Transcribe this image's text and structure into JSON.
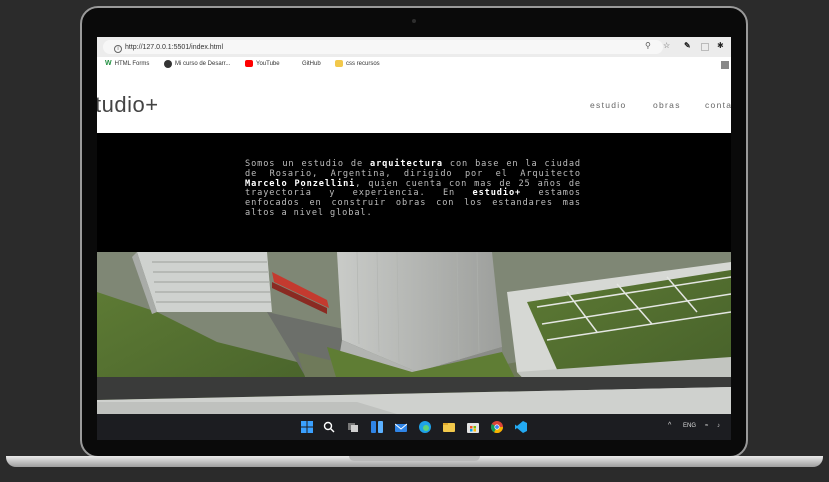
{
  "browser": {
    "url": "http://127.0.0.1:5501/index.html",
    "toolbar_icons": [
      "zoom-icon",
      "star-icon",
      "extension-icon",
      "puzzle-icon"
    ],
    "bookmarks": [
      {
        "label": "HTML Forms",
        "icon": "w-icon",
        "color": "#1e8e3e"
      },
      {
        "label": "Mi curso de Desarr...",
        "icon": "course-icon",
        "color": "#333333"
      },
      {
        "label": "YouTube",
        "icon": "youtube-icon",
        "color": "#ff0000"
      },
      {
        "label": "GitHub",
        "icon": "github-icon",
        "color": "#ffffff"
      },
      {
        "label": "css recursos",
        "icon": "folder-icon",
        "color": "#f2c84b"
      }
    ]
  },
  "site": {
    "logo": "tudio+",
    "nav": [
      "estudio",
      "obras",
      "conta"
    ],
    "about": {
      "p1": "Somos un estudio de ",
      "b1": "arquitectura",
      "p2": " con base en la ciudad de Rosario, Argentina, dirigido por el Arquitecto ",
      "b2": "Marcelo Ponzellini",
      "p3": ", quien cuenta con mas de 25 años de trayectoria y experiencia. En ",
      "b3": "estudio+",
      "p4": " estamos enfocados en construir obras con los estandares mas altos a nivel global."
    }
  },
  "taskbar": {
    "apps": [
      "windows-start-icon",
      "search-icon",
      "task-view-icon",
      "widgets-icon",
      "mail-icon",
      "edge-icon",
      "file-explorer-icon",
      "store-icon",
      "chrome-icon",
      "vscode-icon"
    ],
    "tray_language": "ENG"
  },
  "colors": {
    "page_bg": "#2b2b2b",
    "site_bg": "#000000",
    "accent_bold": "#ffffff",
    "taskbar": "#1c1d21"
  }
}
